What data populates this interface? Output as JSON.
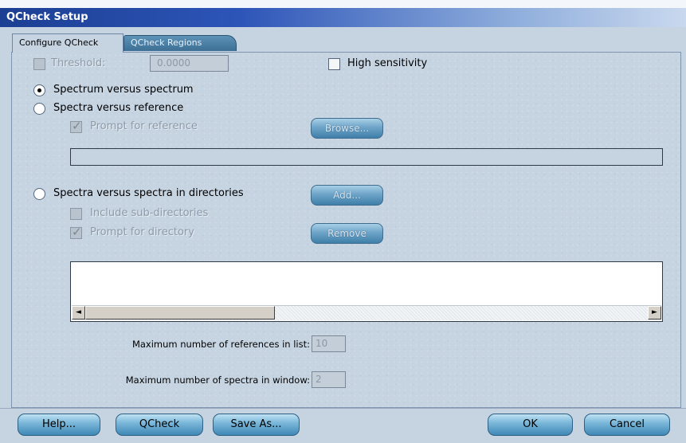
{
  "window": {
    "title": "QCheck Setup"
  },
  "tabs": [
    {
      "label": "Configure QCheck",
      "active": true
    },
    {
      "label": "QCheck Regions",
      "active": false
    }
  ],
  "threshold": {
    "label": "Threshold:",
    "value": "0.0000",
    "checked": false,
    "enabled": false
  },
  "high_sensitivity": {
    "label": "High sensitivity",
    "checked": false
  },
  "modes": [
    {
      "label": "Spectrum versus spectrum",
      "selected": true
    },
    {
      "label": "Spectra versus reference",
      "selected": false
    },
    {
      "label": "Spectra versus spectra in directories",
      "selected": false
    }
  ],
  "prompt_for_reference": {
    "label": "Prompt for reference",
    "checked": true,
    "enabled": false
  },
  "browse_button": {
    "label": "Browse..."
  },
  "reference_path": {
    "value": ""
  },
  "add_button": {
    "label": "Add..."
  },
  "include_subdirs": {
    "label": "Include sub-directories",
    "checked": false,
    "enabled": false
  },
  "prompt_for_directory": {
    "label": "Prompt for directory",
    "checked": true,
    "enabled": false
  },
  "remove_button": {
    "label": "Remove"
  },
  "max_references": {
    "label": "Maximum number of references in list:",
    "value": "10"
  },
  "max_spectra": {
    "label": "Maximum number of spectra in window:",
    "value": "2"
  },
  "footer": {
    "help": "Help...",
    "qcheck": "QCheck",
    "save_as": "Save As...",
    "ok": "OK",
    "cancel": "Cancel"
  },
  "icons": {
    "scroll_left": "◄",
    "scroll_right": "►",
    "checkmark": "✓"
  },
  "colors": {
    "title_bar": "#1c3f93",
    "panel_bg": "#c6d4e2",
    "button_teal": "#3f7fa9"
  }
}
